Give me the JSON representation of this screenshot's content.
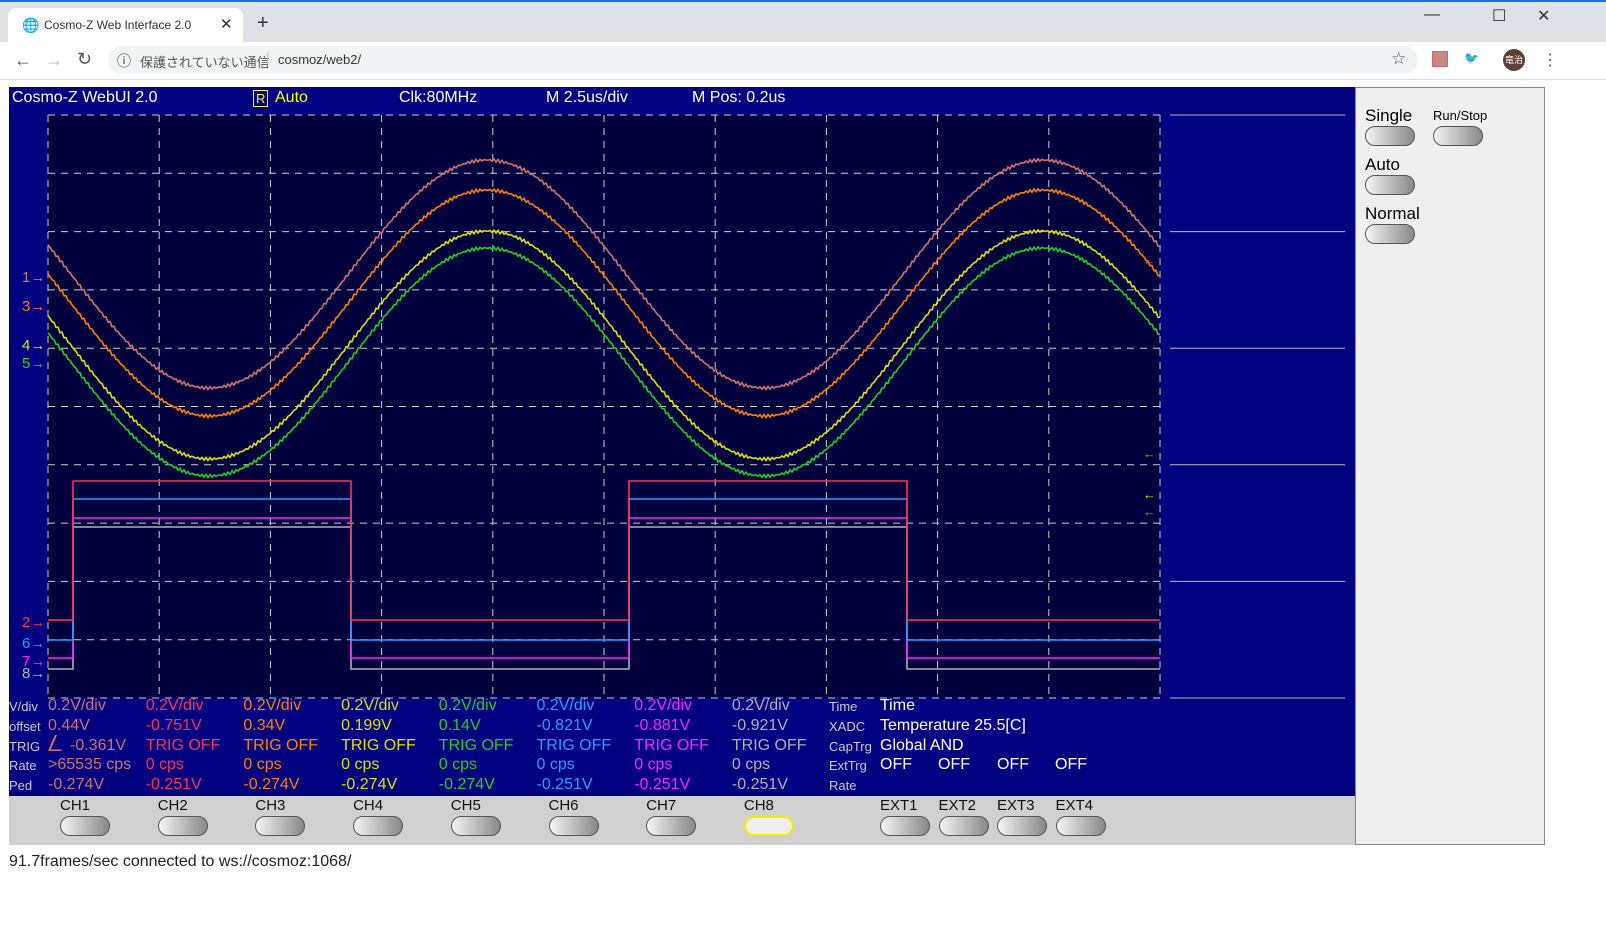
{
  "browser": {
    "tab_title": "Cosmo-Z Web Interface 2.0",
    "security_text": "保護されていない通信",
    "url": "cosmoz/web2/",
    "profile": "竜治"
  },
  "header": {
    "title": "Cosmo-Z WebUI 2.0",
    "trig_badge": "R",
    "mode": "Auto",
    "clock": "Clk:80MHz",
    "timebase": "M 2.5us/div",
    "mpos": "M Pos: 0.2us"
  },
  "row_labels": [
    "V/div",
    "offset",
    "TRIG",
    "Rate",
    "Ped"
  ],
  "channels": [
    {
      "marker": "1",
      "color": "#d07070",
      "vdiv": "0.2V/div",
      "offset": "0.44V",
      "trig": "-0.361V",
      "rate": ">65535 cps",
      "ped": "-0.274V"
    },
    {
      "marker": "2",
      "color": "#ff3050",
      "vdiv": "0.2V/div",
      "offset": "-0.751V",
      "trig": "TRIG OFF",
      "rate": "0 cps",
      "ped": "-0.251V"
    },
    {
      "marker": "3",
      "color": "#ff7f00",
      "vdiv": "0.2V/div",
      "offset": "0.34V",
      "trig": "TRIG OFF",
      "rate": "0 cps",
      "ped": "-0.274V"
    },
    {
      "marker": "4",
      "color": "#e0e000",
      "vdiv": "0.2V/div",
      "offset": "0.199V",
      "trig": "TRIG OFF",
      "rate": "0 cps",
      "ped": "-0.274V"
    },
    {
      "marker": "5",
      "color": "#20d020",
      "vdiv": "0.2V/div",
      "offset": "0.14V",
      "trig": "TRIG OFF",
      "rate": "0 cps",
      "ped": "-0.274V"
    },
    {
      "marker": "6",
      "color": "#20a0ff",
      "vdiv": "0.2V/div",
      "offset": "-0.821V",
      "trig": "TRIG OFF",
      "rate": "0 cps",
      "ped": "-0.251V"
    },
    {
      "marker": "7",
      "color": "#ff20ff",
      "vdiv": "0.2V/div",
      "offset": "-0.881V",
      "trig": "TRIG OFF",
      "rate": "0 cps",
      "ped": "-0.251V"
    },
    {
      "marker": "8",
      "color": "#b0b0b0",
      "vdiv": "0.2V/div",
      "offset": "-0.921V",
      "trig": "TRIG OFF",
      "rate": "0 cps",
      "ped": "-0.251V"
    }
  ],
  "info": {
    "labels": [
      "Time",
      "XADC",
      "CapTrg",
      "ExtTrg",
      "Rate"
    ],
    "time": "Time",
    "xadc": "Temperature 25.5[C]",
    "captrg": "Global AND",
    "exttrg": [
      "OFF",
      "OFF",
      "OFF",
      "OFF"
    ]
  },
  "right_panel": {
    "single": "Single",
    "runstop": "Run/Stop",
    "auto": "Auto",
    "normal": "Normal"
  },
  "buttons": {
    "ch": [
      "CH1",
      "CH2",
      "CH3",
      "CH4",
      "CH5",
      "CH6",
      "CH7",
      "CH8"
    ],
    "ext": [
      "EXT1",
      "EXT2",
      "EXT3",
      "EXT4"
    ],
    "selected": "CH8"
  },
  "status": "91.7frames/sec connected to ws://cosmoz:1068/"
}
